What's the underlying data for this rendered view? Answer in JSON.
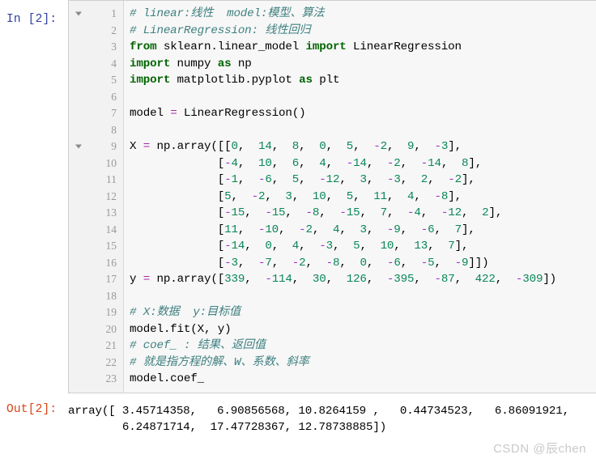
{
  "input_cell": {
    "prompt": "In [2]:",
    "fold_arrow_lines": [
      1,
      9
    ],
    "line_numbers": [
      1,
      2,
      3,
      4,
      5,
      6,
      7,
      8,
      9,
      10,
      11,
      12,
      13,
      14,
      15,
      16,
      17,
      18,
      19,
      20,
      21,
      22,
      23
    ],
    "lines": [
      {
        "n": 1,
        "tokens": [
          {
            "t": "comment",
            "s": "# linear:线性  model:模型、算法"
          }
        ]
      },
      {
        "n": 2,
        "tokens": [
          {
            "t": "comment",
            "s": "# LinearRegression: 线性回归"
          }
        ]
      },
      {
        "n": 3,
        "tokens": [
          {
            "t": "keyword",
            "s": "from"
          },
          {
            "t": "plain",
            "s": " sklearn."
          },
          {
            "t": "plain",
            "s": "linear_model "
          },
          {
            "t": "keyword",
            "s": "import"
          },
          {
            "t": "plain",
            "s": " LinearRegression"
          }
        ]
      },
      {
        "n": 4,
        "tokens": [
          {
            "t": "keyword",
            "s": "import"
          },
          {
            "t": "plain",
            "s": " numpy "
          },
          {
            "t": "keyword",
            "s": "as"
          },
          {
            "t": "plain",
            "s": " np"
          }
        ]
      },
      {
        "n": 5,
        "tokens": [
          {
            "t": "keyword",
            "s": "import"
          },
          {
            "t": "plain",
            "s": " matplotlib."
          },
          {
            "t": "plain",
            "s": "pyplot "
          },
          {
            "t": "keyword",
            "s": "as"
          },
          {
            "t": "plain",
            "s": " plt"
          }
        ]
      },
      {
        "n": 6,
        "tokens": []
      },
      {
        "n": 7,
        "tokens": [
          {
            "t": "plain",
            "s": "model "
          },
          {
            "t": "op",
            "s": "="
          },
          {
            "t": "plain",
            "s": " LinearRegression()"
          }
        ]
      },
      {
        "n": 8,
        "tokens": []
      },
      {
        "n": 9,
        "tokens": [
          {
            "t": "plain",
            "s": "X "
          },
          {
            "t": "op",
            "s": "="
          },
          {
            "t": "plain",
            "s": " np.array([["
          },
          {
            "t": "number",
            "s": "0"
          },
          {
            "t": "plain",
            "s": ",  "
          },
          {
            "t": "number",
            "s": "14"
          },
          {
            "t": "plain",
            "s": ",  "
          },
          {
            "t": "number",
            "s": "8"
          },
          {
            "t": "plain",
            "s": ",  "
          },
          {
            "t": "number",
            "s": "0"
          },
          {
            "t": "plain",
            "s": ",  "
          },
          {
            "t": "number",
            "s": "5"
          },
          {
            "t": "plain",
            "s": ",  "
          },
          {
            "t": "neg",
            "s": "-"
          },
          {
            "t": "number",
            "s": "2"
          },
          {
            "t": "plain",
            "s": ",  "
          },
          {
            "t": "number",
            "s": "9"
          },
          {
            "t": "plain",
            "s": ",  "
          },
          {
            "t": "neg",
            "s": "-"
          },
          {
            "t": "number",
            "s": "3"
          },
          {
            "t": "plain",
            "s": "],"
          }
        ]
      },
      {
        "n": 10,
        "tokens": [
          {
            "t": "plain",
            "s": "             ["
          },
          {
            "t": "neg",
            "s": "-"
          },
          {
            "t": "number",
            "s": "4"
          },
          {
            "t": "plain",
            "s": ",  "
          },
          {
            "t": "number",
            "s": "10"
          },
          {
            "t": "plain",
            "s": ",  "
          },
          {
            "t": "number",
            "s": "6"
          },
          {
            "t": "plain",
            "s": ",  "
          },
          {
            "t": "number",
            "s": "4"
          },
          {
            "t": "plain",
            "s": ",  "
          },
          {
            "t": "neg",
            "s": "-"
          },
          {
            "t": "number",
            "s": "14"
          },
          {
            "t": "plain",
            "s": ",  "
          },
          {
            "t": "neg",
            "s": "-"
          },
          {
            "t": "number",
            "s": "2"
          },
          {
            "t": "plain",
            "s": ",  "
          },
          {
            "t": "neg",
            "s": "-"
          },
          {
            "t": "number",
            "s": "14"
          },
          {
            "t": "plain",
            "s": ",  "
          },
          {
            "t": "number",
            "s": "8"
          },
          {
            "t": "plain",
            "s": "],"
          }
        ]
      },
      {
        "n": 11,
        "tokens": [
          {
            "t": "plain",
            "s": "             ["
          },
          {
            "t": "neg",
            "s": "-"
          },
          {
            "t": "number",
            "s": "1"
          },
          {
            "t": "plain",
            "s": ",  "
          },
          {
            "t": "neg",
            "s": "-"
          },
          {
            "t": "number",
            "s": "6"
          },
          {
            "t": "plain",
            "s": ",  "
          },
          {
            "t": "number",
            "s": "5"
          },
          {
            "t": "plain",
            "s": ",  "
          },
          {
            "t": "neg",
            "s": "-"
          },
          {
            "t": "number",
            "s": "12"
          },
          {
            "t": "plain",
            "s": ",  "
          },
          {
            "t": "number",
            "s": "3"
          },
          {
            "t": "plain",
            "s": ",  "
          },
          {
            "t": "neg",
            "s": "-"
          },
          {
            "t": "number",
            "s": "3"
          },
          {
            "t": "plain",
            "s": ",  "
          },
          {
            "t": "number",
            "s": "2"
          },
          {
            "t": "plain",
            "s": ",  "
          },
          {
            "t": "neg",
            "s": "-"
          },
          {
            "t": "number",
            "s": "2"
          },
          {
            "t": "plain",
            "s": "],"
          }
        ]
      },
      {
        "n": 12,
        "tokens": [
          {
            "t": "plain",
            "s": "             ["
          },
          {
            "t": "number",
            "s": "5"
          },
          {
            "t": "plain",
            "s": ",  "
          },
          {
            "t": "neg",
            "s": "-"
          },
          {
            "t": "number",
            "s": "2"
          },
          {
            "t": "plain",
            "s": ",  "
          },
          {
            "t": "number",
            "s": "3"
          },
          {
            "t": "plain",
            "s": ",  "
          },
          {
            "t": "number",
            "s": "10"
          },
          {
            "t": "plain",
            "s": ",  "
          },
          {
            "t": "number",
            "s": "5"
          },
          {
            "t": "plain",
            "s": ",  "
          },
          {
            "t": "number",
            "s": "11"
          },
          {
            "t": "plain",
            "s": ",  "
          },
          {
            "t": "number",
            "s": "4"
          },
          {
            "t": "plain",
            "s": ",  "
          },
          {
            "t": "neg",
            "s": "-"
          },
          {
            "t": "number",
            "s": "8"
          },
          {
            "t": "plain",
            "s": "],"
          }
        ]
      },
      {
        "n": 13,
        "tokens": [
          {
            "t": "plain",
            "s": "             ["
          },
          {
            "t": "neg",
            "s": "-"
          },
          {
            "t": "number",
            "s": "15"
          },
          {
            "t": "plain",
            "s": ",  "
          },
          {
            "t": "neg",
            "s": "-"
          },
          {
            "t": "number",
            "s": "15"
          },
          {
            "t": "plain",
            "s": ",  "
          },
          {
            "t": "neg",
            "s": "-"
          },
          {
            "t": "number",
            "s": "8"
          },
          {
            "t": "plain",
            "s": ",  "
          },
          {
            "t": "neg",
            "s": "-"
          },
          {
            "t": "number",
            "s": "15"
          },
          {
            "t": "plain",
            "s": ",  "
          },
          {
            "t": "number",
            "s": "7"
          },
          {
            "t": "plain",
            "s": ",  "
          },
          {
            "t": "neg",
            "s": "-"
          },
          {
            "t": "number",
            "s": "4"
          },
          {
            "t": "plain",
            "s": ",  "
          },
          {
            "t": "neg",
            "s": "-"
          },
          {
            "t": "number",
            "s": "12"
          },
          {
            "t": "plain",
            "s": ",  "
          },
          {
            "t": "number",
            "s": "2"
          },
          {
            "t": "plain",
            "s": "],"
          }
        ]
      },
      {
        "n": 14,
        "tokens": [
          {
            "t": "plain",
            "s": "             ["
          },
          {
            "t": "number",
            "s": "11"
          },
          {
            "t": "plain",
            "s": ",  "
          },
          {
            "t": "neg",
            "s": "-"
          },
          {
            "t": "number",
            "s": "10"
          },
          {
            "t": "plain",
            "s": ",  "
          },
          {
            "t": "neg",
            "s": "-"
          },
          {
            "t": "number",
            "s": "2"
          },
          {
            "t": "plain",
            "s": ",  "
          },
          {
            "t": "number",
            "s": "4"
          },
          {
            "t": "plain",
            "s": ",  "
          },
          {
            "t": "number",
            "s": "3"
          },
          {
            "t": "plain",
            "s": ",  "
          },
          {
            "t": "neg",
            "s": "-"
          },
          {
            "t": "number",
            "s": "9"
          },
          {
            "t": "plain",
            "s": ",  "
          },
          {
            "t": "neg",
            "s": "-"
          },
          {
            "t": "number",
            "s": "6"
          },
          {
            "t": "plain",
            "s": ",  "
          },
          {
            "t": "number",
            "s": "7"
          },
          {
            "t": "plain",
            "s": "],"
          }
        ]
      },
      {
        "n": 15,
        "tokens": [
          {
            "t": "plain",
            "s": "             ["
          },
          {
            "t": "neg",
            "s": "-"
          },
          {
            "t": "number",
            "s": "14"
          },
          {
            "t": "plain",
            "s": ",  "
          },
          {
            "t": "number",
            "s": "0"
          },
          {
            "t": "plain",
            "s": ",  "
          },
          {
            "t": "number",
            "s": "4"
          },
          {
            "t": "plain",
            "s": ",  "
          },
          {
            "t": "neg",
            "s": "-"
          },
          {
            "t": "number",
            "s": "3"
          },
          {
            "t": "plain",
            "s": ",  "
          },
          {
            "t": "number",
            "s": "5"
          },
          {
            "t": "plain",
            "s": ",  "
          },
          {
            "t": "number",
            "s": "10"
          },
          {
            "t": "plain",
            "s": ",  "
          },
          {
            "t": "number",
            "s": "13"
          },
          {
            "t": "plain",
            "s": ",  "
          },
          {
            "t": "number",
            "s": "7"
          },
          {
            "t": "plain",
            "s": "],"
          }
        ]
      },
      {
        "n": 16,
        "tokens": [
          {
            "t": "plain",
            "s": "             ["
          },
          {
            "t": "neg",
            "s": "-"
          },
          {
            "t": "number",
            "s": "3"
          },
          {
            "t": "plain",
            "s": ",  "
          },
          {
            "t": "neg",
            "s": "-"
          },
          {
            "t": "number",
            "s": "7"
          },
          {
            "t": "plain",
            "s": ",  "
          },
          {
            "t": "neg",
            "s": "-"
          },
          {
            "t": "number",
            "s": "2"
          },
          {
            "t": "plain",
            "s": ",  "
          },
          {
            "t": "neg",
            "s": "-"
          },
          {
            "t": "number",
            "s": "8"
          },
          {
            "t": "plain",
            "s": ",  "
          },
          {
            "t": "number",
            "s": "0"
          },
          {
            "t": "plain",
            "s": ",  "
          },
          {
            "t": "neg",
            "s": "-"
          },
          {
            "t": "number",
            "s": "6"
          },
          {
            "t": "plain",
            "s": ",  "
          },
          {
            "t": "neg",
            "s": "-"
          },
          {
            "t": "number",
            "s": "5"
          },
          {
            "t": "plain",
            "s": ",  "
          },
          {
            "t": "neg",
            "s": "-"
          },
          {
            "t": "number",
            "s": "9"
          },
          {
            "t": "plain",
            "s": "]])"
          }
        ]
      },
      {
        "n": 17,
        "tokens": [
          {
            "t": "plain",
            "s": "y "
          },
          {
            "t": "op",
            "s": "="
          },
          {
            "t": "plain",
            "s": " np.array(["
          },
          {
            "t": "number",
            "s": "339"
          },
          {
            "t": "plain",
            "s": ",  "
          },
          {
            "t": "neg",
            "s": "-"
          },
          {
            "t": "number",
            "s": "114"
          },
          {
            "t": "plain",
            "s": ",  "
          },
          {
            "t": "number",
            "s": "30"
          },
          {
            "t": "plain",
            "s": ",  "
          },
          {
            "t": "number",
            "s": "126"
          },
          {
            "t": "plain",
            "s": ",  "
          },
          {
            "t": "neg",
            "s": "-"
          },
          {
            "t": "number",
            "s": "395"
          },
          {
            "t": "plain",
            "s": ",  "
          },
          {
            "t": "neg",
            "s": "-"
          },
          {
            "t": "number",
            "s": "87"
          },
          {
            "t": "plain",
            "s": ",  "
          },
          {
            "t": "number",
            "s": "422"
          },
          {
            "t": "plain",
            "s": ",  "
          },
          {
            "t": "neg",
            "s": "-"
          },
          {
            "t": "number",
            "s": "309"
          },
          {
            "t": "plain",
            "s": "])"
          }
        ]
      },
      {
        "n": 18,
        "tokens": []
      },
      {
        "n": 19,
        "tokens": [
          {
            "t": "comment",
            "s": "# X:数据  y:目标值"
          }
        ]
      },
      {
        "n": 20,
        "tokens": [
          {
            "t": "plain",
            "s": "model.fit(X, y)"
          }
        ]
      },
      {
        "n": 21,
        "tokens": [
          {
            "t": "comment",
            "s": "# coef_ : 结果、返回值"
          }
        ]
      },
      {
        "n": 22,
        "tokens": [
          {
            "t": "comment",
            "s": "# 就是指方程的解、W、系数、斜率"
          }
        ]
      },
      {
        "n": 23,
        "tokens": [
          {
            "t": "plain",
            "s": "model.coef_"
          }
        ]
      }
    ]
  },
  "output_cell": {
    "prompt": "Out[2]:",
    "text_line_1": "array([ 3.45714358,   6.90856568, 10.8264159 ,   0.44734523,   6.86091921,",
    "text_line_2": "        6.24871714,  17.47728367, 12.78738885])"
  },
  "output_values": [
    3.45714358,
    6.90856568,
    10.8264159,
    0.44734523,
    6.86091921,
    6.24871714,
    17.47728367,
    12.78738885
  ],
  "watermark": "CSDN @辰chen",
  "colors": {
    "prompt_in": "#303F9F",
    "prompt_out": "#D84315",
    "comment": "#408080",
    "keyword": "#006400",
    "number": "#098658",
    "negative": "#9933cc",
    "operator": "#a626a4",
    "cell_bg": "#f7f7f7",
    "gutter_bg": "#f2f2f2",
    "cell_border": "#cfcfcf",
    "watermark": "#c9c9c9"
  }
}
